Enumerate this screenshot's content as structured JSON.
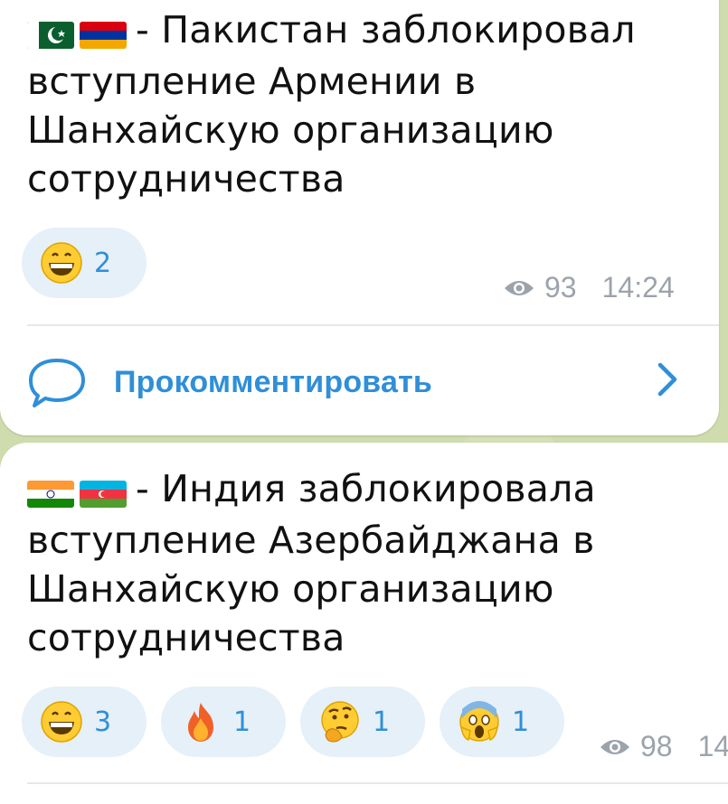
{
  "posts": [
    {
      "text": "- Пакистан заблокировал вступление Армении в Шанхайскую организацию сотрудничества",
      "flags": [
        "pakistan-flag-icon",
        "armenia-flag-icon"
      ],
      "reactions": [
        {
          "emoji": "grinning-face-icon",
          "count": "2"
        }
      ],
      "views": "93",
      "time": "14:24"
    },
    {
      "text": "- Индия заблокировала вступление Азербайджана в Шанхайскую организацию сотрудничества",
      "flags": [
        "india-flag-icon",
        "azerbaijan-flag-icon"
      ],
      "reactions": [
        {
          "emoji": "grinning-face-icon",
          "count": "3"
        },
        {
          "emoji": "fire-icon",
          "count": "1"
        },
        {
          "emoji": "thinking-face-icon",
          "count": "1"
        },
        {
          "emoji": "screaming-face-icon",
          "count": "1"
        }
      ],
      "views": "98",
      "time": "14"
    }
  ],
  "comment": {
    "label": "Прокомментировать",
    "icon": "speech-bubble-icon"
  },
  "colors": {
    "accent": "#2f8fd8",
    "pill": "#e5f0f9",
    "meta": "#9ca3ab"
  }
}
